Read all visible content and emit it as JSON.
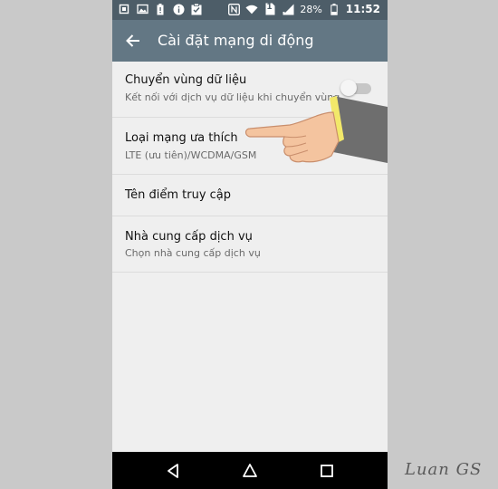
{
  "status_bar": {
    "left_icons": [
      "notification-square-icon",
      "image-icon",
      "battery-alert-icon",
      "info-icon",
      "clipboard-check-icon"
    ],
    "right_icons": [
      "nfc-icon",
      "wifi-icon",
      "sim-icon",
      "signal-icon",
      "battery-icon"
    ],
    "sim_label": "1",
    "battery_percent": "28%",
    "time": "11:52"
  },
  "app_bar": {
    "back_icon": "arrow-left-icon",
    "title": "Cài đặt mạng di động",
    "color": "#637784"
  },
  "settings": [
    {
      "title": "Chuyển vùng dữ liệu",
      "subtitle": "Kết nối với dịch vụ dữ liệu khi chuyển vùng",
      "toggle_on": false
    },
    {
      "title": "Loại mạng ưa thích",
      "subtitle": "LTE (ưu tiên)/WCDMA/GSM"
    },
    {
      "title": "Tên điểm truy cập"
    },
    {
      "title": "Nhà cung cấp dịch vụ",
      "subtitle": "Chọn nhà cung cấp dịch vụ"
    }
  ],
  "nav_bar": {
    "icons": [
      "back-triangle-icon",
      "home-circle-icon",
      "recents-square-icon"
    ]
  },
  "overlay": {
    "pointer": "pointing-hand-icon"
  },
  "watermark": "Luan GS"
}
